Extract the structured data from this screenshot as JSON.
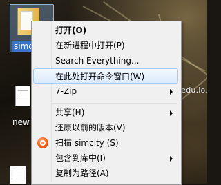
{
  "desktop": {
    "folder_label": "simcity",
    "file_label": "new",
    "watermark": "www.edu.io.com"
  },
  "context_menu": {
    "items": [
      {
        "label": "打开(O)",
        "bold": true
      },
      {
        "label": "在新进程中打开(P)"
      },
      {
        "label": "Search Everything..."
      },
      {
        "label": "在此处打开命令窗口(W)",
        "highlighted": true
      },
      {
        "label": "7-Zip",
        "submenu": true
      },
      {
        "label": "共享(H)",
        "submenu": true
      },
      {
        "label": "还原以前的版本(V)"
      },
      {
        "label": "扫描 simcity (S)",
        "icon": "scan-icon"
      },
      {
        "label": "包含到库中(I)",
        "submenu": true
      },
      {
        "label": "复制为路径(A)"
      }
    ]
  },
  "colors": {
    "menu_background": "#f0f0f0",
    "highlight_border": "#a8cdf2",
    "selection_label_bg": "#3b73c8"
  }
}
